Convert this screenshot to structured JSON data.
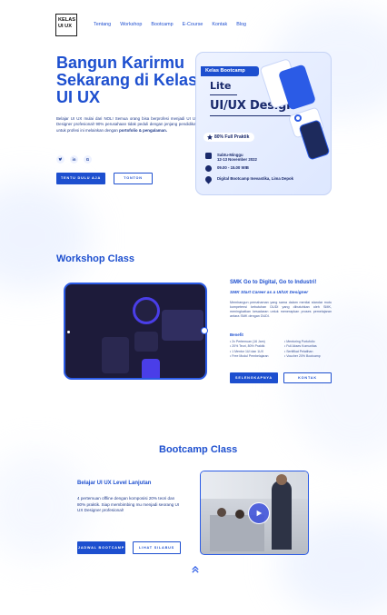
{
  "header": {
    "logo": "KELAS UI UX",
    "nav": [
      "Tentang",
      "Workshop",
      "Bootcamp",
      "E-Course",
      "Kontak",
      "Blog"
    ]
  },
  "hero": {
    "title": "Bangun Karirmu Sekarang di Kelas UI UX",
    "desc_main": "Belajar UI UX mulai dari NOL! Semua orang bisa berprofesi menjadi UI UX Designer profesional! 90% perusahaan tidak peduli dengan jenjang pendidikan untuk profesi ini melainkan dengan ",
    "desc_bold": "portofolio & pengalaman.",
    "socials": [
      "Twitter",
      "LinkedIn",
      "Google"
    ],
    "btn_primary": "TENTU DULU AJA",
    "btn_secondary": "TONTON",
    "card": {
      "tag": "Kelas Bootcamp",
      "line1": "Lite",
      "line2": "UI/UX Design",
      "badge": "80% Full Praktik",
      "date_line1": "Sabtu-Minggu",
      "date_line2": "12-13 November 2022",
      "time": "09.00 - 15.00 WIB",
      "place": "Digital Bootcamp Inevastika, Lima Depok"
    }
  },
  "workshop": {
    "section_title": "Workshop Class",
    "heading": "SMK Go to Digital, Go to Industri!",
    "subheading": "SMK Start Career as a UI/UX Designer",
    "desc": "Membangun pemahaman yang sama dalam menilai standar mutu kompetensi kebutuhan DUDI yang dibutuhkan oleh SMK, meningkatkan kesadaran untuk menerapkan proses pemelajaran antara SMK dengan DUDI.",
    "benefit_label": "Benefit",
    "benefits_left": [
      "2x Pertemuan (16 Jam)",
      "20% Teori, 80% Praktik",
      "1 Mentor 1UI dan 1UX",
      "Free Modul Pembelajaran"
    ],
    "benefits_right": [
      "Mentoring Portofolio",
      "Full Akses Komunitas",
      "Sertifikat Pelatihan",
      "Voucher 20% Bootcamp"
    ],
    "btn_primary": "SELENGKAPNYA",
    "btn_secondary": "KONTAK"
  },
  "bootcamp": {
    "section_title": "Bootcamp Class",
    "heading": "Belajar UI UX Level Lanjutan",
    "desc": "4 pertemuan offline dengan komposisi 20% teori dan 80% praktik. Siap membimbing mu menjadi seorang UI UX Designer profesional!",
    "btn_primary": "JADWAL BOOTCAMP",
    "btn_secondary": "LIHAT SILABUS"
  },
  "colors": {
    "primary": "#1d4fcf",
    "navy": "#1a2a6c",
    "accent": "#2b5be6"
  }
}
